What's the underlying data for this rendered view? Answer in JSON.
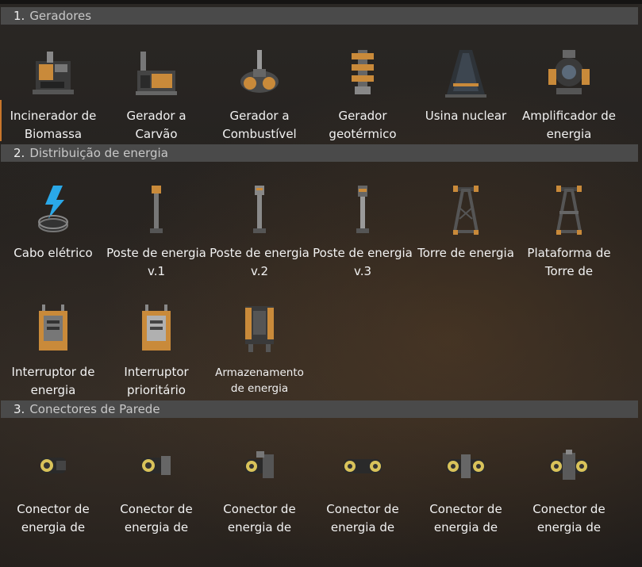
{
  "sections": [
    {
      "number": "1.",
      "title": "Geradores",
      "items": [
        {
          "label": "Incinerador de Biomassa",
          "icon": "biomass-burner-icon"
        },
        {
          "label": "Gerador a Carvão",
          "icon": "coal-generator-icon"
        },
        {
          "label": "Gerador a Combustível",
          "icon": "fuel-generator-icon"
        },
        {
          "label": "Gerador geotérmico",
          "icon": "geothermal-generator-icon"
        },
        {
          "label": "Usina nuclear",
          "icon": "nuclear-plant-icon"
        },
        {
          "label": "Amplificador de energia",
          "icon": "power-augmenter-icon"
        }
      ]
    },
    {
      "number": "2.",
      "title": "Distribuição de energia",
      "items": [
        {
          "label": "Cabo elétrico",
          "icon": "power-cable-icon"
        },
        {
          "label": "Poste de energia v.1",
          "icon": "power-pole-v1-icon"
        },
        {
          "label": "Poste de energia v.2",
          "icon": "power-pole-v2-icon"
        },
        {
          "label": "Poste de energia v.3",
          "icon": "power-pole-v3-icon"
        },
        {
          "label": "Torre de energia",
          "icon": "power-tower-icon"
        },
        {
          "label": "Plataforma de Torre de",
          "icon": "power-tower-platform-icon"
        },
        {
          "label": "Interruptor de energia",
          "icon": "power-switch-icon"
        },
        {
          "label": "Interruptor prioritário",
          "icon": "priority-switch-icon"
        },
        {
          "label": "Armazenamento de energia",
          "icon": "power-storage-icon"
        }
      ]
    },
    {
      "number": "3.",
      "title": "Conectores de Parede",
      "items": [
        {
          "label": "Conector de energia de",
          "icon": "wall-outlet-1-icon"
        },
        {
          "label": "Conector de energia de",
          "icon": "wall-outlet-2-icon"
        },
        {
          "label": "Conector de energia de",
          "icon": "wall-outlet-3-icon"
        },
        {
          "label": "Conector de energia de",
          "icon": "wall-outlet-4-icon"
        },
        {
          "label": "Conector de energia de",
          "icon": "wall-outlet-5-icon"
        },
        {
          "label": "Conector de energia de",
          "icon": "wall-outlet-6-icon"
        }
      ]
    }
  ]
}
